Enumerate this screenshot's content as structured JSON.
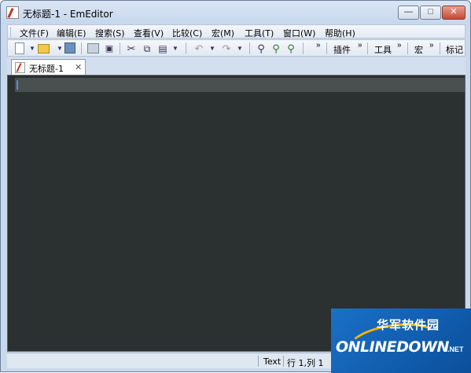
{
  "window": {
    "title": "无标题-1 - EmEditor",
    "controls": {
      "minimize": "—",
      "maximize": "□",
      "close": "✕"
    }
  },
  "menu": [
    "文件(F)",
    "编辑(E)",
    "搜索(S)",
    "查看(V)",
    "比较(C)",
    "宏(M)",
    "工具(T)",
    "窗口(W)",
    "帮助(H)"
  ],
  "toolbar": {
    "overflow_glyph": "»",
    "groups": [
      "插件",
      "工具",
      "宏",
      "标记"
    ]
  },
  "tab": {
    "label": "无标题-1",
    "close": "✕"
  },
  "status": {
    "mode": "Text",
    "position": "行 1,列 1"
  },
  "watermark": {
    "cn": "华军软件园",
    "en": "ONLINEDOWN",
    "suffix": ".NET"
  }
}
